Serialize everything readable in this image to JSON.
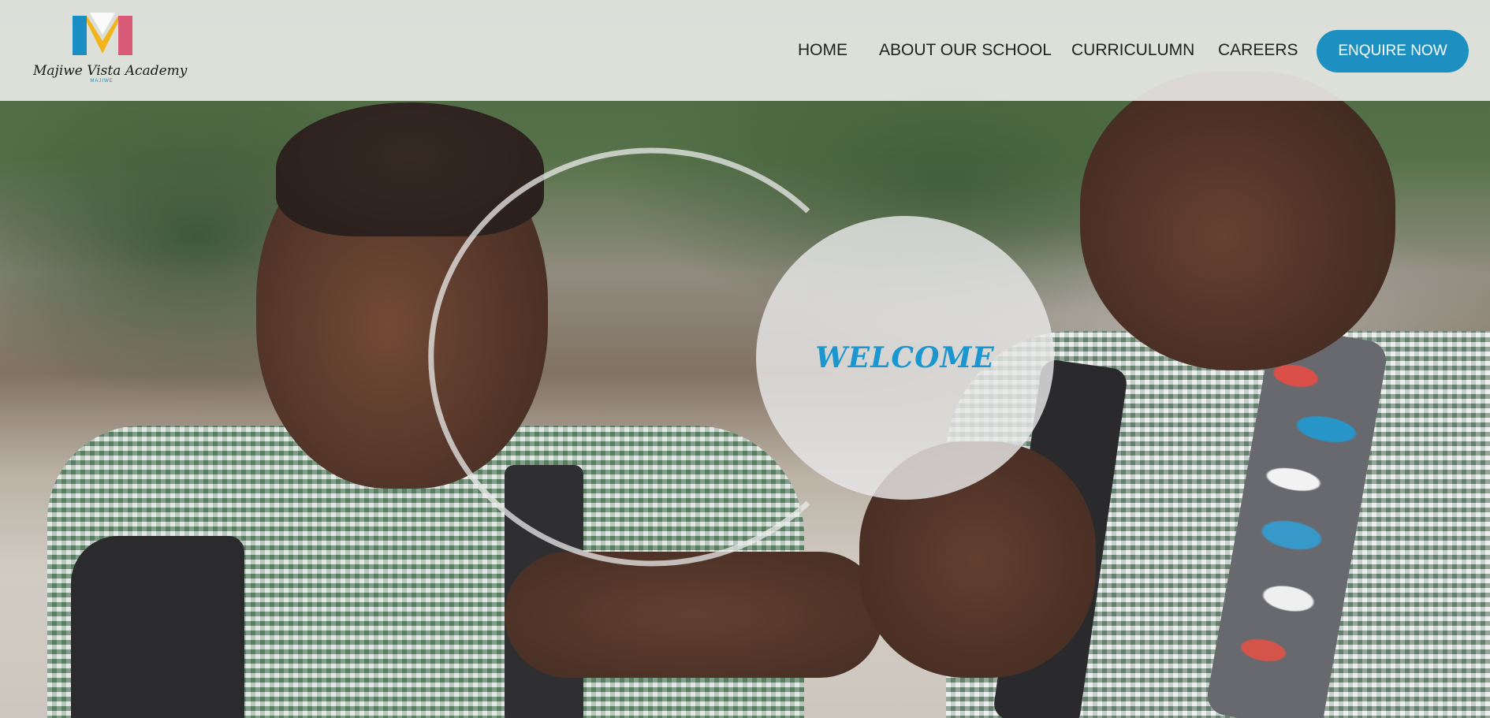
{
  "header": {
    "logo": {
      "mark_letter": "M",
      "name": "Majiwe Vista Academy",
      "subname": "MAJIWE"
    },
    "nav": [
      {
        "label": "HOME"
      },
      {
        "label": "ABOUT OUR SCHOOL"
      },
      {
        "label": "CURRICULUMN"
      },
      {
        "label": "CAREERS"
      }
    ],
    "cta_label": "ENQUIRE NOW"
  },
  "hero": {
    "welcome_text": "WELCOME",
    "image_subject": "two-smiling-schoolboys-photo"
  },
  "colors": {
    "accent_blue": "#1d8fc0",
    "welcome_blue": "#1b96cf",
    "logo_blue": "#1a8fc4",
    "logo_yellow": "#f2b41c",
    "logo_pink": "#d95b77",
    "header_bg": "#f0f0ee"
  }
}
